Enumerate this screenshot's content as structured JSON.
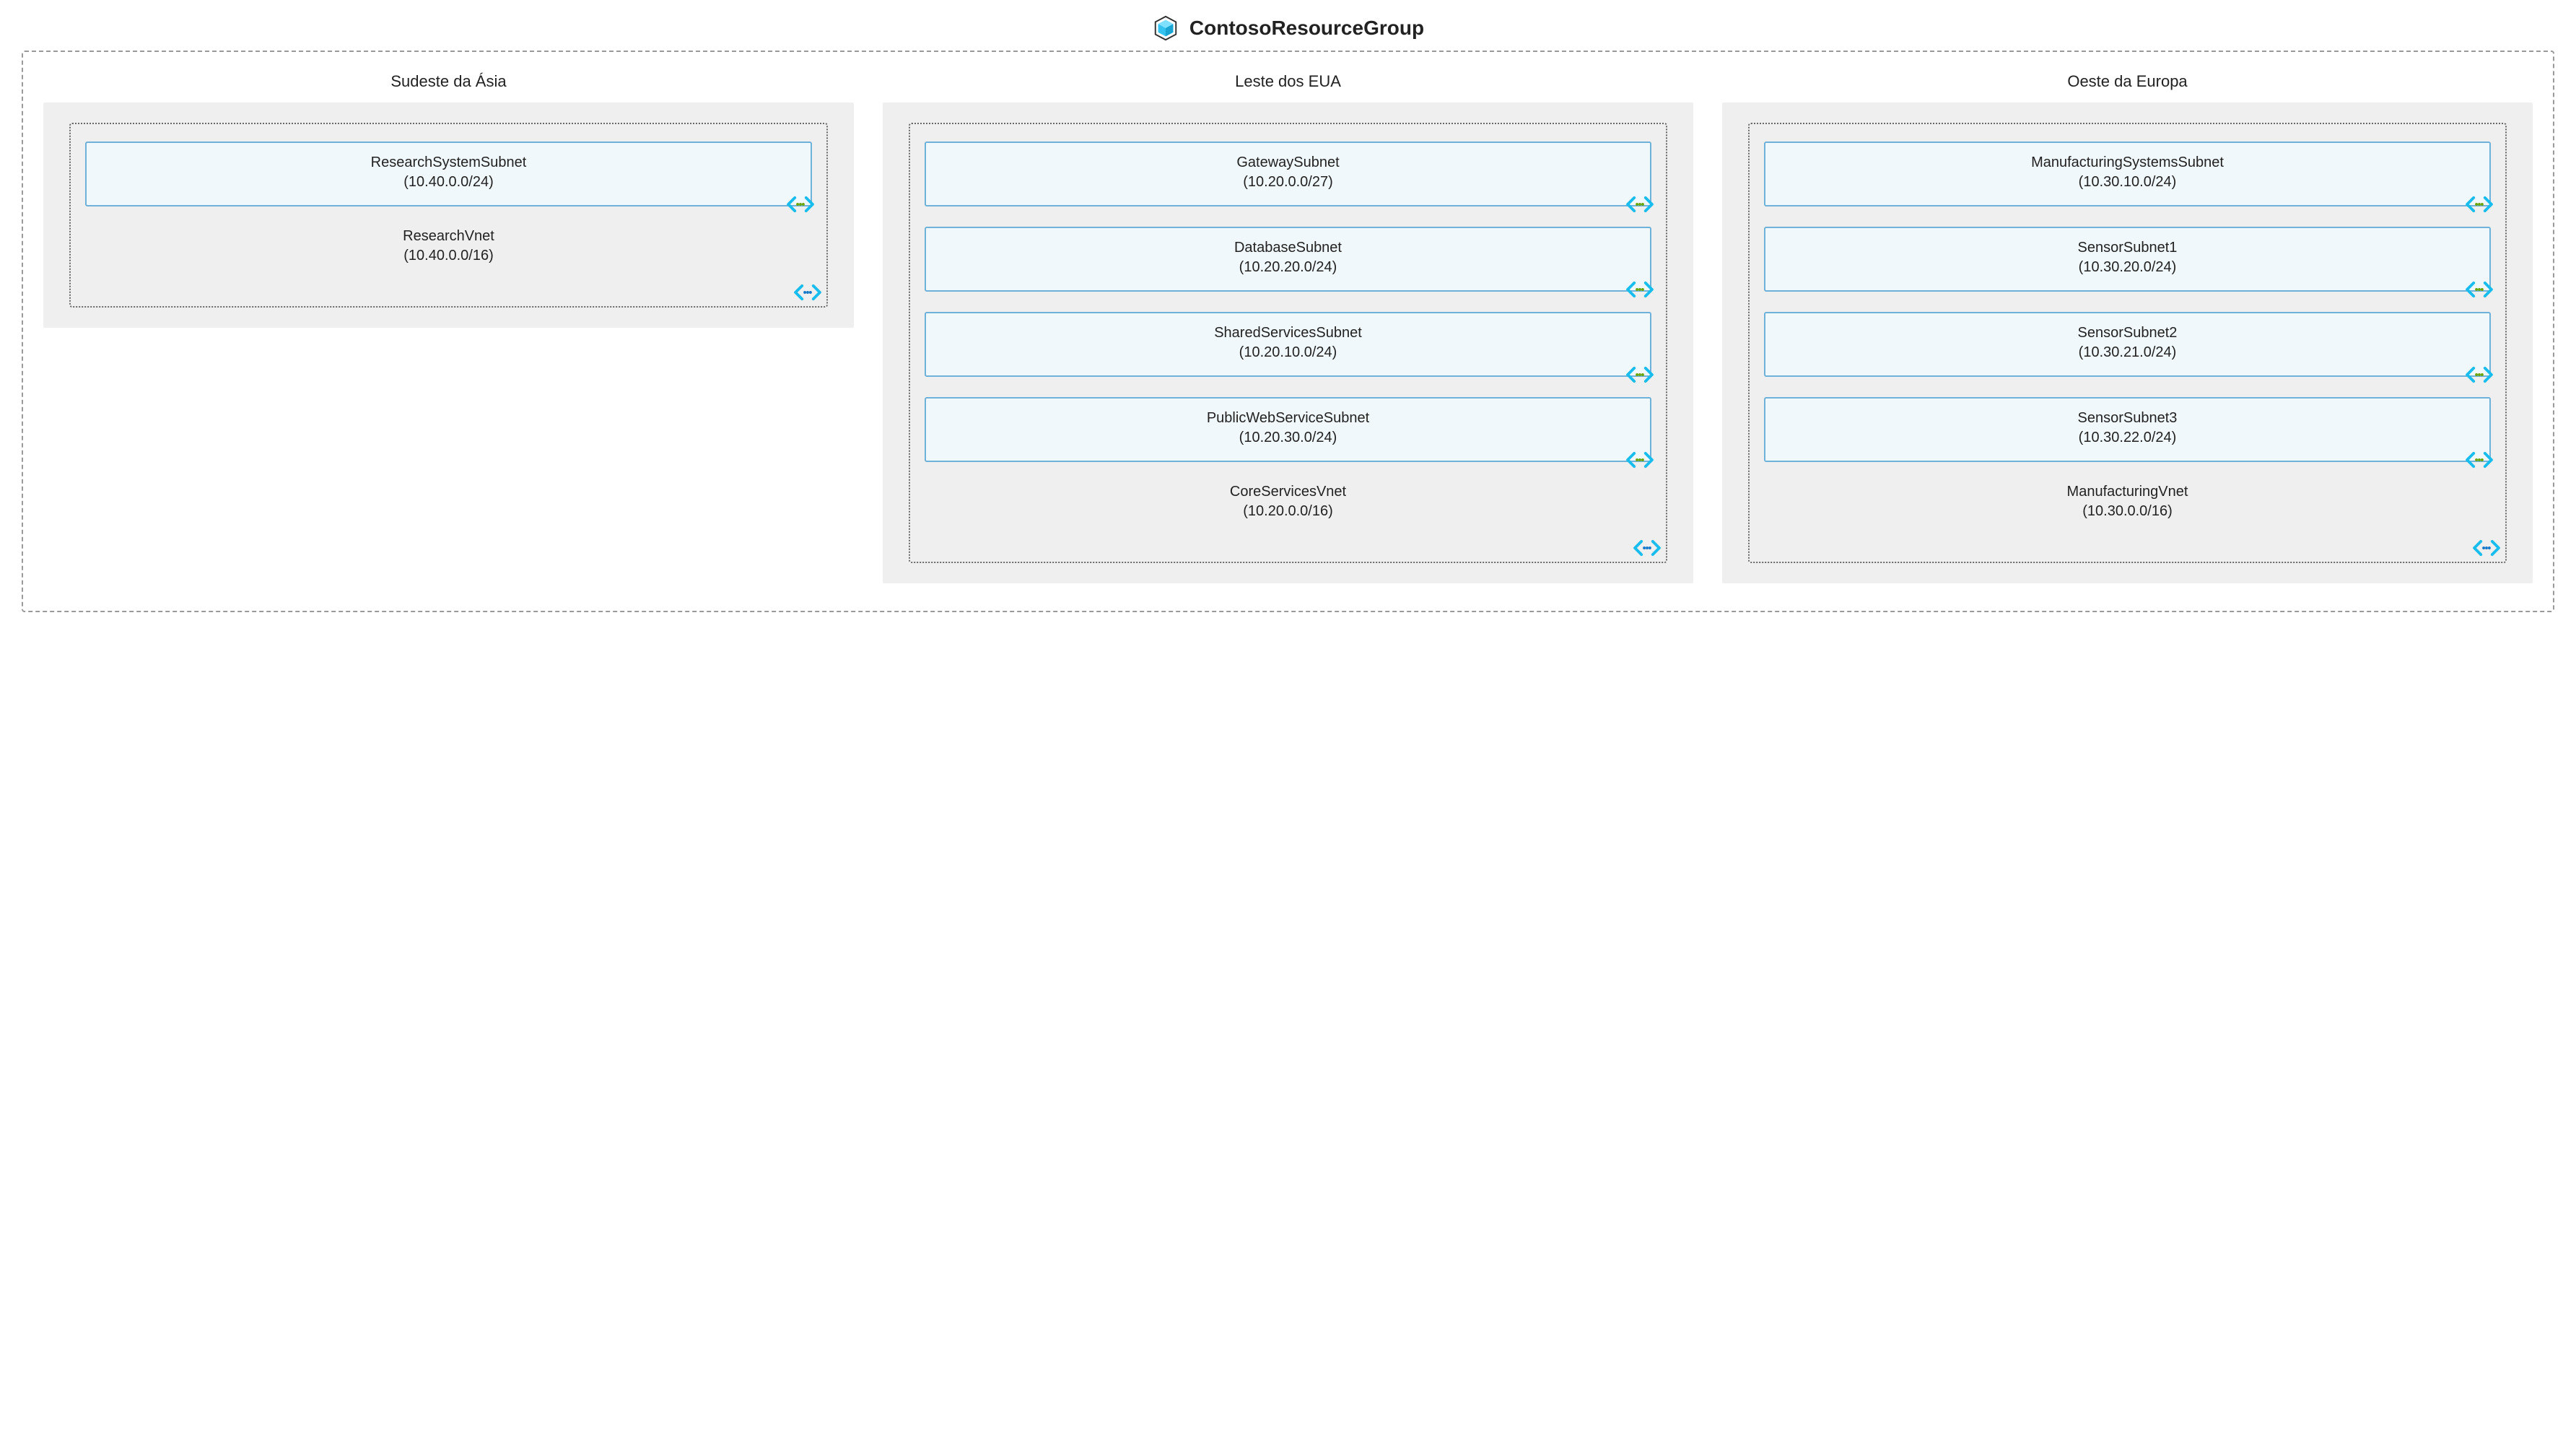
{
  "resourceGroup": {
    "name": "ContosoResourceGroup"
  },
  "regions": [
    {
      "title": "Sudeste da Ásia",
      "vnet": {
        "name": "ResearchVnet",
        "address": "(10.40.0.0/16)",
        "subnets": [
          {
            "name": "ResearchSystemSubnet",
            "address": "(10.40.0.0/24)"
          }
        ]
      }
    },
    {
      "title": "Leste dos EUA",
      "vnet": {
        "name": "CoreServicesVnet",
        "address": "(10.20.0.0/16)",
        "subnets": [
          {
            "name": "GatewaySubnet",
            "address": "(10.20.0.0/27)"
          },
          {
            "name": "DatabaseSubnet",
            "address": "(10.20.20.0/24)"
          },
          {
            "name": "SharedServicesSubnet",
            "address": "(10.20.10.0/24)"
          },
          {
            "name": "PublicWebServiceSubnet",
            "address": "(10.20.30.0/24)"
          }
        ]
      }
    },
    {
      "title": "Oeste da Europa",
      "vnet": {
        "name": "ManufacturingVnet",
        "address": "(10.30.0.0/16)",
        "subnets": [
          {
            "name": "ManufacturingSystemsSubnet",
            "address": "(10.30.10.0/24)"
          },
          {
            "name": "SensorSubnet1",
            "address": "(10.30.20.0/24)"
          },
          {
            "name": "SensorSubnet2",
            "address": "(10.30.21.0/24)"
          },
          {
            "name": "SensorSubnet3",
            "address": "(10.30.22.0/24)"
          }
        ]
      }
    }
  ]
}
